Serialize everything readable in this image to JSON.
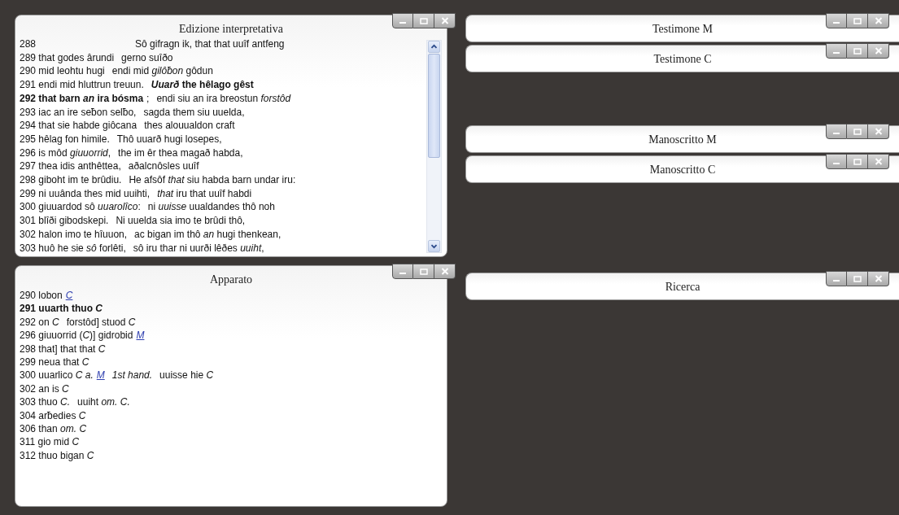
{
  "left_column": [
    {
      "title": "Edizione interpretativa",
      "kind": "verses",
      "scrollbar": true,
      "lines": [
        {
          "segments": [
            {
              "text": "288"
            },
            {
              "text": "Sô gifragn ik, that that uuîf antfeng",
              "kind": "indent"
            }
          ]
        },
        {
          "segments": [
            {
              "text": "289 that godes ârundi"
            },
            {
              "text": "gerno suîðo"
            }
          ]
        },
        {
          "segments": [
            {
              "text": "290 mid leohtu hugi"
            },
            {
              "text": "endi mid *gilôƀon* gôdun"
            }
          ]
        },
        {
          "segments": [
            {
              "text": "291 endi mid hluttrun treuun."
            },
            {
              "text": "*Uuarð* the hêlago gêst",
              "bold": true
            }
          ]
        },
        {
          "segments": [
            {
              "text": "292 that barn *an* ira bósma",
              "bold": true
            },
            {
              "text": ";",
              "kind": "tight"
            },
            {
              "text": "endi siu an ira breostun *forstôd*"
            }
          ]
        },
        {
          "segments": [
            {
              "text": "293 iac an ire seƀon selƀo,"
            },
            {
              "text": "sagda them siu uuelda,"
            }
          ]
        },
        {
          "segments": [
            {
              "text": "294 that sie habde giôcana"
            },
            {
              "text": "thes alouualdon craft"
            }
          ]
        },
        {
          "segments": [
            {
              "text": "295 hêlag fon himile."
            },
            {
              "text": "Thô uuarð hugi losepes,"
            }
          ]
        },
        {
          "segments": [
            {
              "text": "296 is môd *giuuorrid*,"
            },
            {
              "text": "the im êr thea magað habda,"
            }
          ]
        },
        {
          "segments": [
            {
              "text": "297 thea idis anthêttea,"
            },
            {
              "text": "aðalcnôsles uuîf"
            }
          ]
        },
        {
          "segments": [
            {
              "text": "298 giboht im te brûdiu."
            },
            {
              "text": "He afsôf *that* siu habda barn undar iru:"
            }
          ]
        },
        {
          "segments": [
            {
              "text": "299 ni uuânda thes mid uuihti,"
            },
            {
              "text": "*that* iru that uuîf habdi"
            }
          ]
        },
        {
          "segments": [
            {
              "text": "300 giuuardod sô *uuarolîco*:"
            },
            {
              "text": "ni *uuisse* uualdandes thô noh"
            }
          ]
        },
        {
          "segments": [
            {
              "text": "301 blîði gibodskepi."
            },
            {
              "text": "Ni uuelda sia imo te brûdi thô,"
            }
          ]
        },
        {
          "segments": [
            {
              "text": "302 halon imo te hîuuon,"
            },
            {
              "text": "ac bigan im thô *an* hugi thenkean,"
            }
          ]
        },
        {
          "segments": [
            {
              "text": "303 huô he sie *sô* forlêti,"
            },
            {
              "text": "sô iru thar ni uurði lêðes *uuiht*,"
            }
          ]
        }
      ]
    },
    {
      "title": "Apparato",
      "kind": "apparatus",
      "scrollbar": false,
      "lines": [
        {
          "segments": [
            {
              "text": "290 lobon"
            },
            {
              "text": "C",
              "kind": "link"
            }
          ]
        },
        {
          "segments": [
            {
              "text": "291 uuarth thuo *C*",
              "bold": true
            }
          ]
        },
        {
          "segments": [
            {
              "text": "292 on *C*"
            },
            {
              "text": "forstôd] stuod *C*"
            }
          ]
        },
        {
          "segments": [
            {
              "text": "296 giuuorrid (*C*)] gidrobid"
            },
            {
              "text": "M",
              "kind": "link"
            }
          ]
        },
        {
          "segments": [
            {
              "text": "298 that] that that *C*"
            }
          ]
        },
        {
          "segments": [
            {
              "text": "299 neua that *C*"
            }
          ]
        },
        {
          "segments": [
            {
              "text": "300 uuarlico *C a.*"
            },
            {
              "text": "M",
              "kind": "link"
            },
            {
              "text": "*1st hand.*"
            },
            {
              "text": "uuisse hie *C*"
            }
          ]
        },
        {
          "segments": [
            {
              "text": "302 an is *C*"
            }
          ]
        },
        {
          "segments": [
            {
              "text": "303 thuo *C.*"
            },
            {
              "text": "uuiht *om. C.*"
            }
          ]
        },
        {
          "segments": [
            {
              "text": "304 arƀedies *C*"
            }
          ]
        },
        {
          "segments": [
            {
              "text": "306 than *om. C*"
            }
          ]
        },
        {
          "segments": [
            {
              "text": "311 gio mid *C*"
            }
          ]
        },
        {
          "segments": [
            {
              "text": "312 thuo bigan *C*"
            }
          ]
        }
      ]
    }
  ],
  "right_column": [
    {
      "windows": [
        {
          "title": "Testimone M"
        },
        {
          "title": "Testimone C"
        }
      ]
    },
    {
      "windows": [
        {
          "title": "Manoscritto M"
        },
        {
          "title": "Manoscritto C"
        }
      ]
    },
    {
      "windows": [
        {
          "title": "Ricerca"
        }
      ]
    }
  ]
}
